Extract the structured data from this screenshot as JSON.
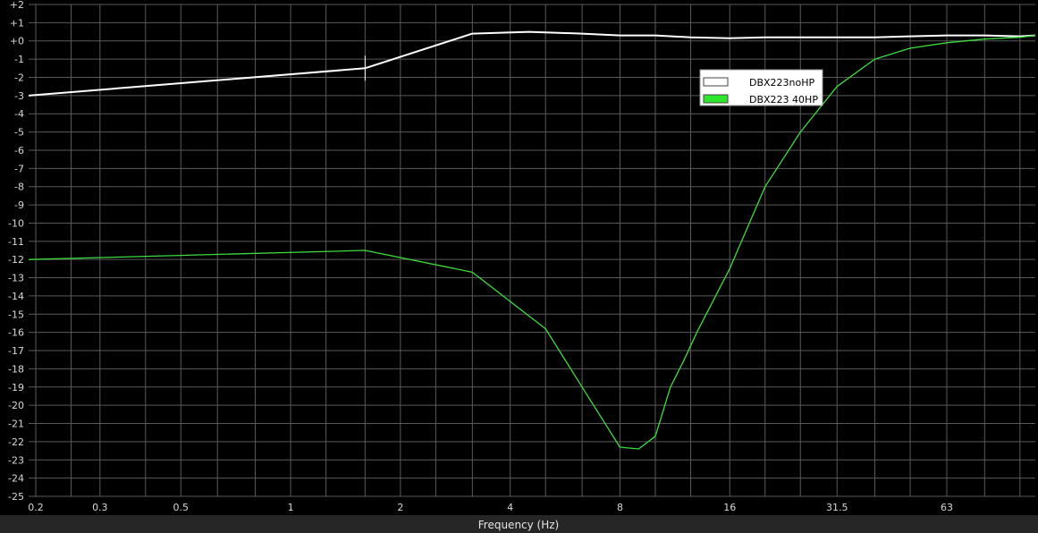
{
  "chart_data": {
    "type": "line",
    "title": "",
    "xlabel": "Frequency (Hz)",
    "ylabel": "",
    "x_scale": "log",
    "xlim": [
      0.18,
      125
    ],
    "ylim": [
      -25,
      2
    ],
    "grid": true,
    "x_ticks": [
      "0.2",
      "0.3",
      "0.5",
      "1",
      "2",
      "4",
      "8",
      "16",
      "31.5",
      "63"
    ],
    "y_ticks": [
      "+2",
      "+1",
      "+0",
      "-1",
      "-2",
      "-3",
      "-4",
      "-5",
      "-6",
      "-7",
      "-8",
      "-9",
      "-10",
      "-11",
      "-12",
      "-13",
      "-14",
      "-15",
      "-16",
      "-17",
      "-18",
      "-19",
      "-20",
      "-21",
      "-22",
      "-23",
      "-24",
      "-25"
    ],
    "legend_position": "upper-center-right",
    "series": [
      {
        "name": "DBX223noHP",
        "color": "#ffffff",
        "x": [
          0.18,
          1.6,
          3.15,
          4.5,
          6.3,
          8,
          10,
          12.5,
          16,
          20,
          25,
          31.5,
          40,
          50,
          63,
          80,
          100,
          125
        ],
        "y": [
          -3.0,
          -1.5,
          0.4,
          0.5,
          0.4,
          0.3,
          0.3,
          0.2,
          0.15,
          0.2,
          0.2,
          0.2,
          0.2,
          0.25,
          0.3,
          0.3,
          0.25,
          0.3
        ]
      },
      {
        "name": "DBX223 40HP",
        "color": "#3ddc3d",
        "x": [
          0.18,
          1.6,
          3.15,
          5,
          6.3,
          8,
          9,
          10,
          11,
          12,
          13,
          16,
          20,
          25,
          31.5,
          40,
          50,
          63,
          80,
          100,
          125
        ],
        "y": [
          -12.0,
          -11.5,
          -12.7,
          -15.8,
          -19.0,
          -22.3,
          -22.4,
          -21.7,
          -19.0,
          -17.5,
          -16.0,
          -12.5,
          -8.0,
          -5.0,
          -2.5,
          -1.0,
          -0.4,
          -0.1,
          0.1,
          0.2,
          0.3
        ]
      }
    ]
  },
  "legend": {
    "items": [
      {
        "label": "DBX223noHP",
        "swatch": "#ffffff"
      },
      {
        "label": "DBX223 40HP",
        "swatch": "#2ee62e"
      }
    ]
  },
  "colors": {
    "background": "#000000",
    "grid": "#5a5a5a",
    "axis_text": "#d8d8d8",
    "footer": "#262626"
  }
}
